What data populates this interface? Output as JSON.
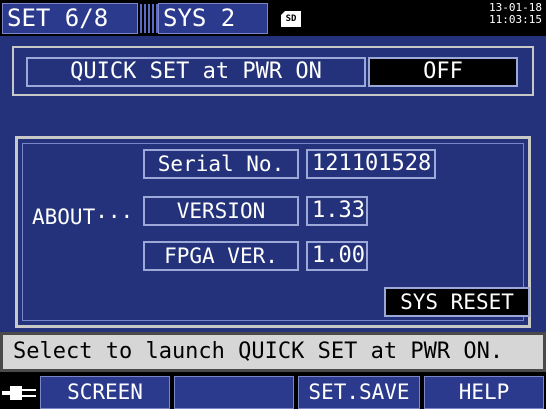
{
  "topbar": {
    "set_tab": "SET  6/8",
    "sys_tab": "SYS  2",
    "sd_label": "SD",
    "date": "13-01-18",
    "time": "11:03:15"
  },
  "quick_set": {
    "label": "QUICK SET at PWR ON",
    "value": "OFF"
  },
  "about": {
    "label": "ABOUT···",
    "serial_label": "Serial No.",
    "serial_value": "121101528",
    "version_label": "VERSION",
    "version_value": "1.33",
    "fpga_label": "FPGA VER.",
    "fpga_value": "1.00",
    "sys_reset": "SYS RESET"
  },
  "help_text": "Select to launch QUICK SET at PWR ON.",
  "fkeys": {
    "f1": "SCREEN",
    "f2": "",
    "f3": "SET.SAVE",
    "f4": "HELP"
  },
  "icons": {
    "plug": "power-plug-icon",
    "sd": "sd-card-icon"
  }
}
